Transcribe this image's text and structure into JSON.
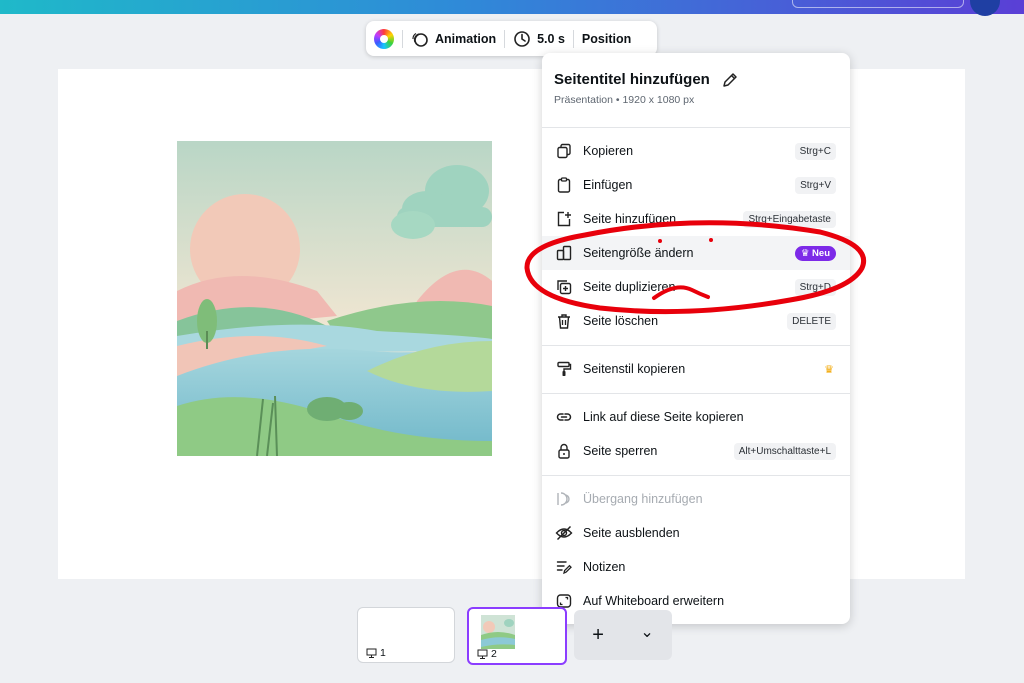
{
  "toolbar": {
    "animation_label": "Animation",
    "duration_label": "5.0 s",
    "position_label": "Position"
  },
  "menu": {
    "title": "Seitentitel hinzufügen",
    "subtitle": "Präsentation • 1920 x 1080 px",
    "items": [
      {
        "label": "Kopieren",
        "shortcut": "Strg+C",
        "icon": "copy-icon"
      },
      {
        "label": "Einfügen",
        "shortcut": "Strg+V",
        "icon": "paste-icon"
      },
      {
        "label": "Seite hinzufügen",
        "shortcut": "Strg+Eingabetaste",
        "icon": "add-page-icon"
      },
      {
        "label": "Seitengröße ändern",
        "badge": "Neu",
        "icon": "resize-icon"
      },
      {
        "label": "Seite duplizieren",
        "shortcut": "Strg+D",
        "icon": "duplicate-icon"
      },
      {
        "label": "Seite löschen",
        "shortcut": "DELETE",
        "icon": "trash-icon"
      },
      {
        "label": "Seitenstil kopieren",
        "icon": "paint-roller-icon",
        "premium": true
      },
      {
        "label": "Link auf diese Seite kopieren",
        "icon": "link-icon"
      },
      {
        "label": "Seite sperren",
        "shortcut": "Alt+Umschalttaste+L",
        "icon": "lock-icon"
      },
      {
        "label": "Übergang hinzufügen",
        "icon": "transition-icon",
        "disabled": true
      },
      {
        "label": "Seite ausblenden",
        "icon": "eye-off-icon"
      },
      {
        "label": "Notizen",
        "icon": "notes-icon"
      },
      {
        "label": "Auf Whiteboard erweitern",
        "icon": "whiteboard-icon"
      }
    ]
  },
  "pages": {
    "thumb1_number": "1",
    "thumb2_number": "2",
    "add_symbol": "+",
    "chevron_symbol": "⌄"
  },
  "colors": {
    "accent": "#8b3dff",
    "badge": "#7d2ae8",
    "annotation_red": "#e8000b"
  }
}
